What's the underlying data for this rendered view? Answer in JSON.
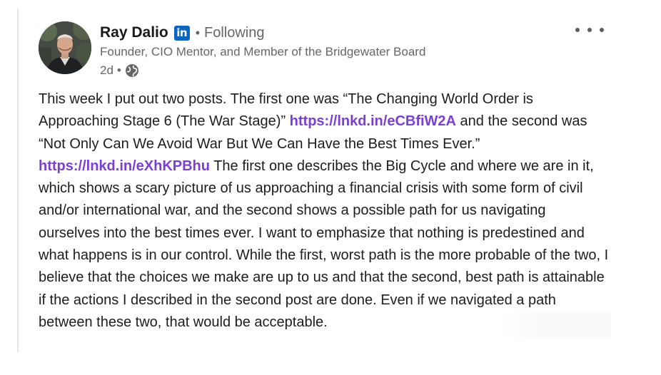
{
  "author": {
    "name": "Ray Dalio",
    "badge": "in",
    "follow_status": "Following",
    "headline": "Founder, CIO Mentor, and Member of the Bridgewater Board",
    "time_ago": "2d",
    "visibility_icon": "globe-icon",
    "avatar": "profile-photo"
  },
  "menu": {
    "icon": "more-options-icon"
  },
  "post": {
    "seg_1": "This week I put out two posts. The first one was “The Changing World Order is Approaching Stage 6 (The War Stage)” ",
    "link_1": "https://lnkd.in/eCBfiW2A",
    "seg_2": " and the second was “Not Only Can We Avoid War But We Can Have the Best Times Ever.” ",
    "link_2": "https://lnkd.in/eXhKPBhu",
    "seg_3": " The first one describes the Big Cycle and where we are in it, which shows a scary picture of us approaching a financial crisis with some form of civil and/or international war, and the second shows a possible path for us navigating ourselves into the best times ever. I want to emphasize that nothing is predestined and what happens is in our control. While the first, worst path is the more probable of the two, I believe that the choices we make are up to us and that the second, best path is attainable if the actions I described in the second post are done. Even if we navigated a path between these two, that would be acceptable."
  },
  "colors": {
    "link": "#7b3fd1",
    "linkedin_blue": "#0a66c2",
    "text": "#1d1d1d",
    "muted": "#666666"
  }
}
